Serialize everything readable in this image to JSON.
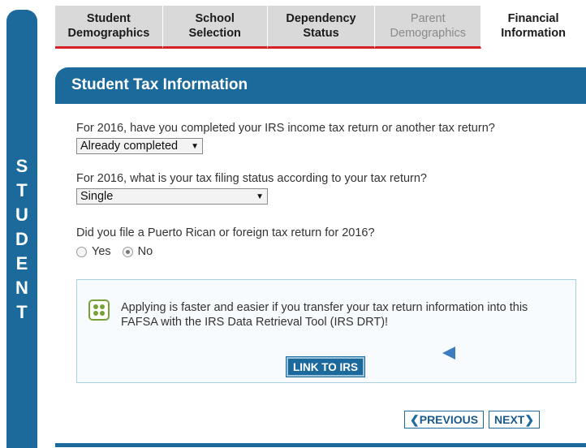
{
  "side": {
    "letters": [
      "S",
      "T",
      "U",
      "D",
      "E",
      "N",
      "T"
    ]
  },
  "tabs": [
    {
      "l1": "Student",
      "l2": "Demographics",
      "state": "normal"
    },
    {
      "l1": "School",
      "l2": "Selection",
      "state": "normal"
    },
    {
      "l1": "Dependency",
      "l2": "Status",
      "state": "normal"
    },
    {
      "l1": "Parent",
      "l2": "Demographics",
      "state": "disabled"
    },
    {
      "l1": "Financial",
      "l2": "Information",
      "state": "active"
    }
  ],
  "panel": {
    "title": "Student Tax Information"
  },
  "q1": {
    "text": "For 2016, have you completed your IRS income tax return or another tax return?",
    "value": "Already completed"
  },
  "q2": {
    "text": "For 2016, what is your tax filing status according to your tax return?",
    "value": "Single"
  },
  "q3": {
    "text": "Did you file a Puerto Rican or foreign tax return for 2016?",
    "yes": "Yes",
    "no": "No",
    "selected": "No"
  },
  "info": {
    "text": "Applying is faster and easier if you transfer your tax return information into this FAFSA with the IRS Data Retrieval Tool (IRS DRT)!",
    "button": "LINK TO IRS"
  },
  "nav": {
    "previous": "PREVIOUS",
    "next": "NEXT"
  },
  "colors": {
    "brand_blue": "#1b6a9b",
    "tab_underline": "#d6232a",
    "drt_green": "#77a336"
  }
}
